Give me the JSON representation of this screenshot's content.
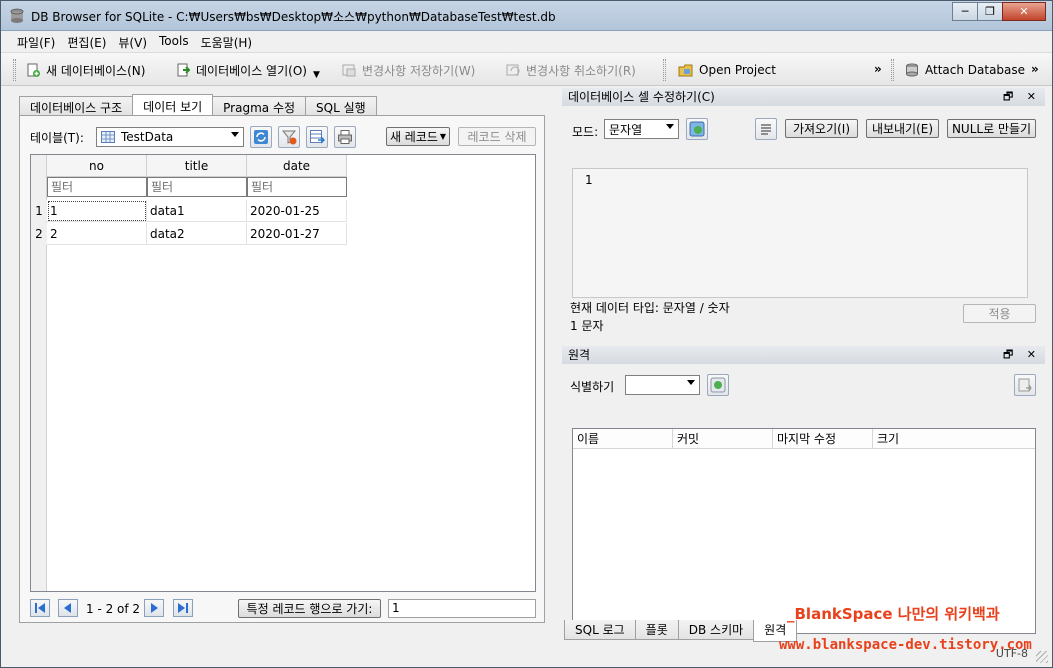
{
  "window": {
    "title": "DB Browser for SQLite - C:₩Users₩bs₩Desktop₩소스₩python₩DatabaseTest₩test.db"
  },
  "menu": [
    "파일(F)",
    "편집(E)",
    "뷰(V)",
    "Tools",
    "도움말(H)"
  ],
  "toolbar": {
    "new_db": "새 데이터베이스(N)",
    "open_db": "데이터베이스 열기(O)",
    "write_changes": "변경사항 저장하기(W)",
    "revert_changes": "변경사항 취소하기(R)",
    "open_project": "Open Project",
    "attach_db": "Attach Database",
    "more": "»"
  },
  "left_tabs": [
    "데이터베이스 구조",
    "데이터 보기",
    "Pragma 수정",
    "SQL 실행"
  ],
  "browse": {
    "table_label": "테이블(T):",
    "table_selected": "TestData",
    "new_record": "새 레코드",
    "delete_record": "레코드 삭제",
    "columns": [
      "no",
      "title",
      "date"
    ],
    "filter_placeholder": "필터",
    "rows": [
      {
        "num": "1",
        "cells": [
          "1",
          "data1",
          "2020-01-25"
        ]
      },
      {
        "num": "2",
        "cells": [
          "2",
          "data2",
          "2020-01-27"
        ]
      }
    ],
    "page_info": "1 - 2 of 2",
    "goto_label": "특정 레코드 행으로 가기:",
    "goto_value": "1"
  },
  "edit_cell": {
    "dock_title": "데이터베이스 셀 수정하기(C)",
    "mode_label": "모드:",
    "mode_value": "문자열",
    "import": "가져오기(I)",
    "export": "내보내기(E)",
    "set_null": "NULL로 만들기",
    "content": "1",
    "type_info": "현재 데이터 타입: 문자열 / 숫자",
    "size_info": "1 문자",
    "apply": "적용"
  },
  "remote": {
    "dock_title": "원격",
    "identity_label": "식별하기",
    "columns": [
      "이름",
      "커밋",
      "마지막 수정",
      "크기"
    ]
  },
  "bottom_tabs": [
    "SQL 로그",
    "플롯",
    "DB 스키마",
    "원격"
  ],
  "status": {
    "encoding": "UTF-8"
  },
  "watermark": {
    "line1": "_BlankSpace 나만의 위키백과",
    "line2": "www.blankspace-dev.tistory.com"
  },
  "dock_controls": "🗗 ✕"
}
